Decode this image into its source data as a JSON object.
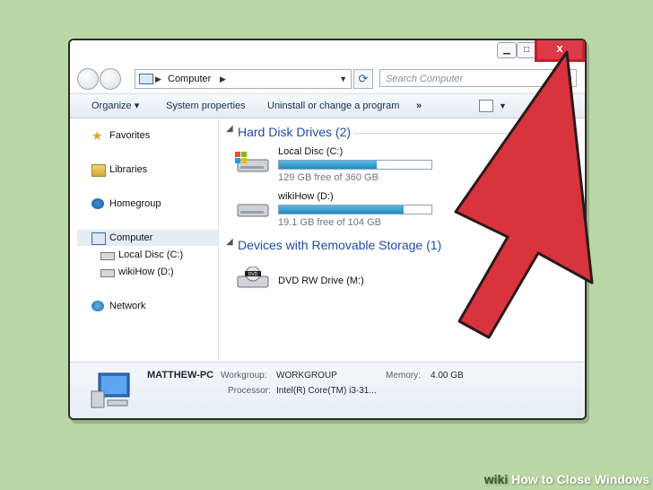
{
  "window": {
    "controls": {
      "minimize": "▁",
      "maximize": "□",
      "close": "x"
    }
  },
  "address_bar": {
    "location": "Computer",
    "search_placeholder": "Search Computer"
  },
  "toolbar": {
    "organize": "Organize ▾",
    "system_properties": "System properties",
    "uninstall": "Uninstall or change a program",
    "more": "»"
  },
  "sidebar": {
    "items": [
      {
        "label": "Favorites",
        "icon": "star-icon"
      },
      {
        "label": "Libraries",
        "icon": "library-icon"
      },
      {
        "label": "Homegroup",
        "icon": "homegroup-icon"
      },
      {
        "label": "Computer",
        "icon": "computer-icon"
      },
      {
        "label": "Local Disc (C:)",
        "icon": "drive-icon"
      },
      {
        "label": "wikiHow (D:)",
        "icon": "drive-icon"
      },
      {
        "label": "Network",
        "icon": "network-icon"
      }
    ]
  },
  "content": {
    "hard_disk_header": "Hard Disk Drives (2)",
    "drives": [
      {
        "name": "Local Disc (C:)",
        "free": "129 GB free of 360 GB",
        "used_fraction": 0.64
      },
      {
        "name": "wikiHow (D:)",
        "free": "19.1 GB free of 104 GB",
        "used_fraction": 0.82
      }
    ],
    "removable_header": "Devices with Removable Storage (1)",
    "removable": [
      {
        "name": "DVD RW Drive (M:)",
        "icon": "dvd-drive-icon"
      }
    ]
  },
  "details": {
    "computer_name": "MATTHEW-PC",
    "workgroup_label": "Workgroup:",
    "workgroup": "WORKGROUP",
    "memory_label": "Memory:",
    "memory": "4.00 GB",
    "processor_label": "Processor:",
    "processor": "Intel(R) Core(TM) i3-31..."
  },
  "colors": {
    "arrow": "#d9333e",
    "arrow_outline": "#b0232d",
    "close_highlight": "#dc3b47",
    "background": "#b9d7a4"
  },
  "caption": {
    "prefix": "wiki",
    "title": "How to Close Windows"
  }
}
